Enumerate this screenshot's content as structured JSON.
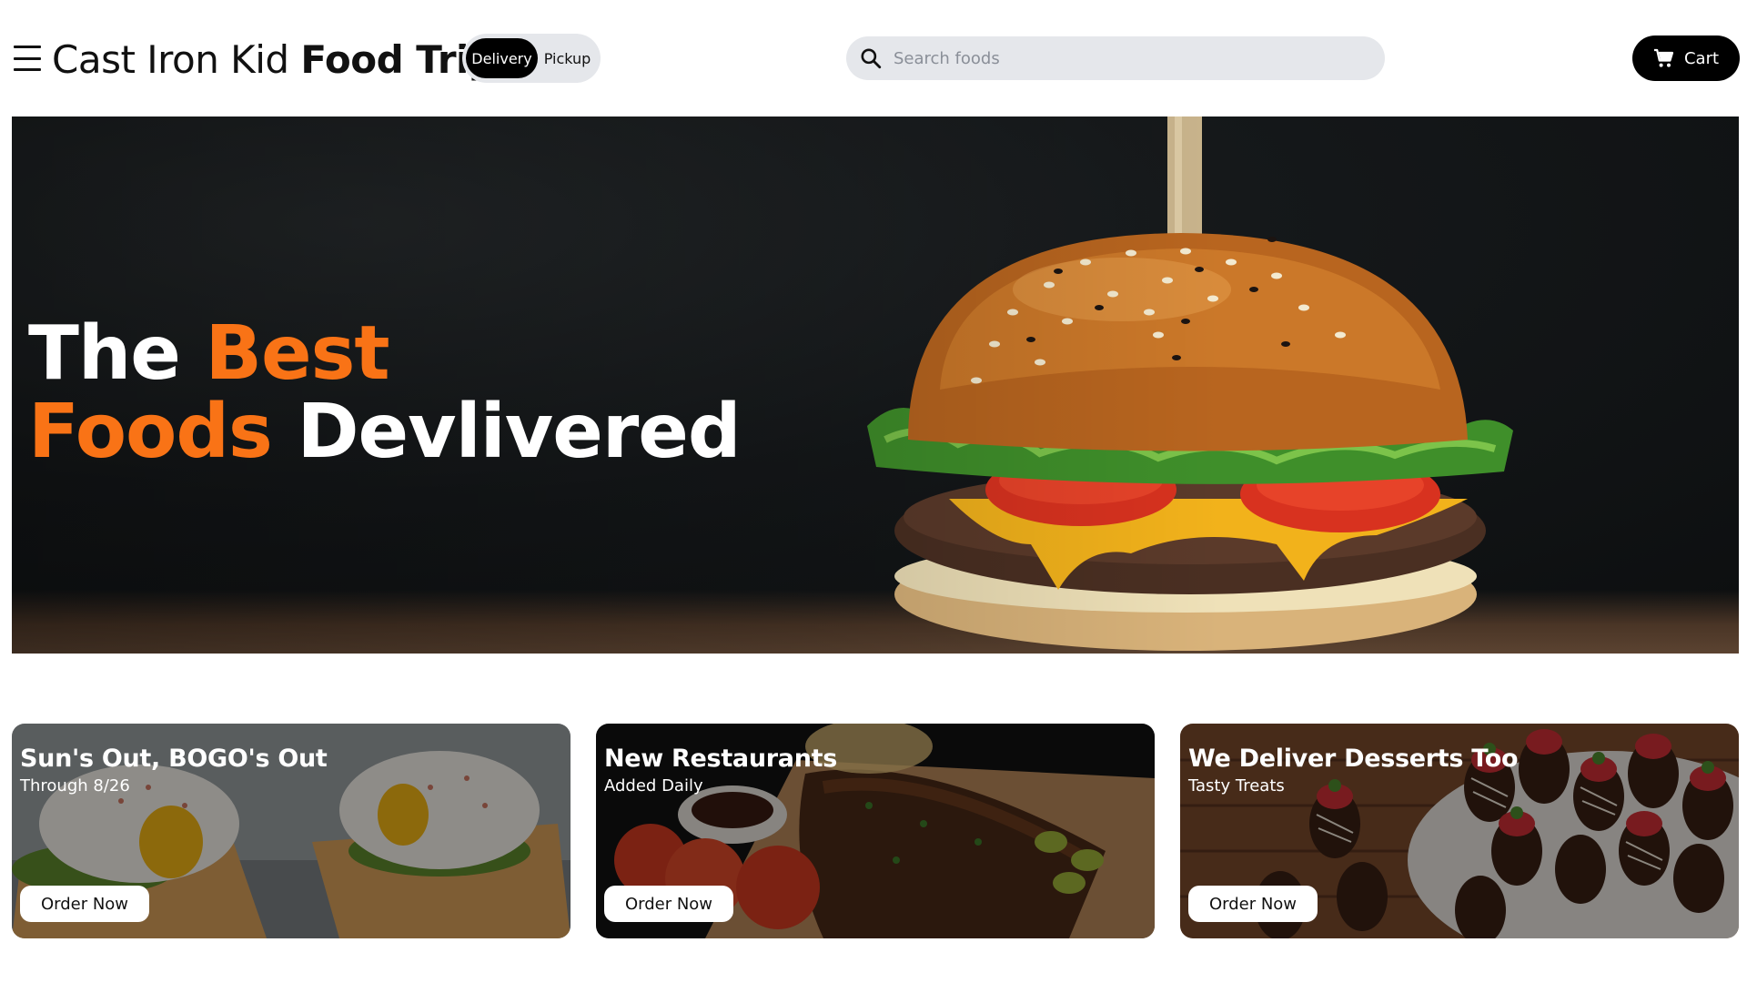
{
  "header": {
    "brand_light": "Cast Iron Kid",
    "brand_bold": "Food Trip",
    "toggle": {
      "delivery": "Delivery",
      "pickup": "Pickup",
      "selected": "Delivery"
    },
    "search": {
      "placeholder": "Search foods",
      "value": ""
    },
    "cart_label": "Cart",
    "icons": [
      "menu-icon",
      "search-icon",
      "cart-icon"
    ]
  },
  "hero": {
    "line1_white": "The",
    "line1_accent": "Best",
    "line2_accent": "Foods",
    "line2_white": "Devlivered",
    "image": "burger-image"
  },
  "cards": [
    {
      "title": "Sun's Out, BOGO's Out",
      "subtitle": "Through 8/26",
      "button": "Order Now",
      "image": "eggs-benedict-image"
    },
    {
      "title": "New Restaurants",
      "subtitle": "Added Daily",
      "button": "Order Now",
      "image": "ribs-platter-image"
    },
    {
      "title": "We Deliver Desserts Too",
      "subtitle": "Tasty Treats",
      "button": "Order Now",
      "image": "chocolate-strawberries-image"
    }
  ],
  "colors": {
    "accent": "#f97316",
    "toggle_bg": "#e5e7eb",
    "search_bg": "#e5e7eb",
    "button_dark": "#000000",
    "text": "#111111"
  }
}
